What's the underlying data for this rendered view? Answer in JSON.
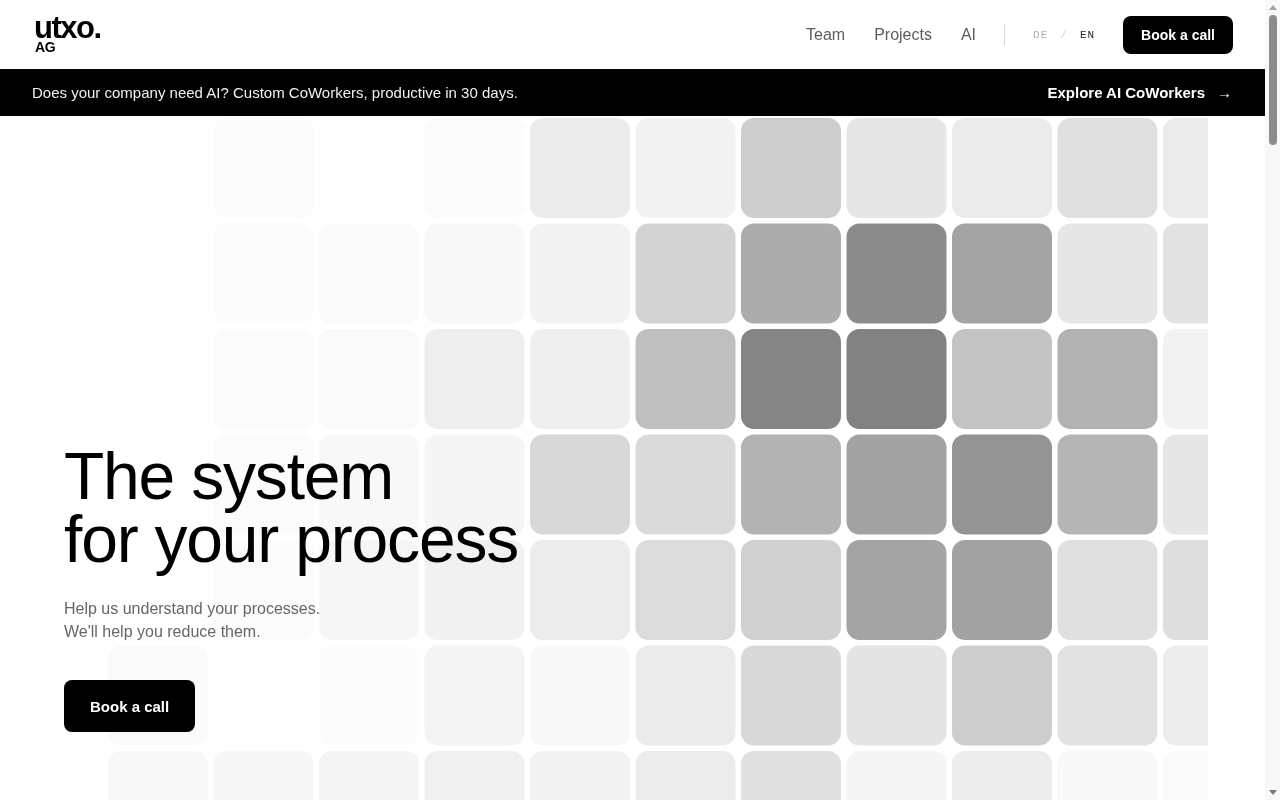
{
  "header": {
    "logo": {
      "wordmark": "utxo.",
      "suffix": "AG"
    },
    "nav": [
      "Team",
      "Projects",
      "AI"
    ],
    "languages": [
      {
        "label": "DE",
        "selected": false
      },
      {
        "label": "EN",
        "selected": true
      }
    ],
    "language_separator": "/",
    "cta_button": "Book a call"
  },
  "banner": {
    "text": "Does your company need AI? Custom CoWorkers, productive in 30 days.",
    "link": {
      "label": "Explore AI CoWorkers",
      "arrow": "→"
    }
  },
  "hero": {
    "heading": "The system\nfor your process",
    "subtitle": "Help us understand your processes.\nWe'll help you reduce them.",
    "button": "Book a call"
  }
}
